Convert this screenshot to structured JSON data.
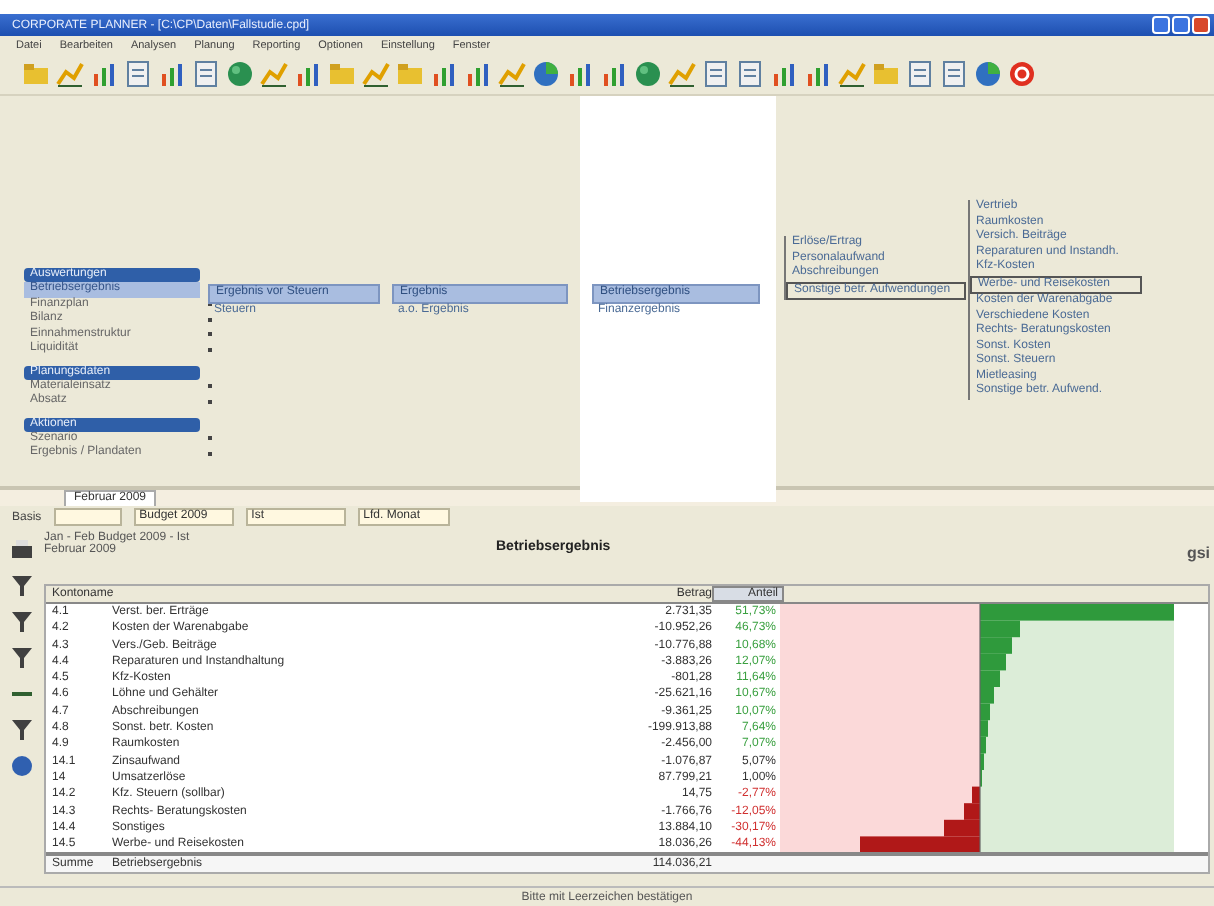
{
  "window": {
    "title": "CORPORATE PLANNER - [C:\\CP\\Daten\\Fallstudie.cpd]"
  },
  "menu": [
    "Datei",
    "Bearbeiten",
    "Analysen",
    "Planung",
    "Reporting",
    "Optionen",
    "Einstellung",
    "Fenster"
  ],
  "diagram": {
    "sidebar_groups": [
      {
        "title": "Auswertungen",
        "items": [
          {
            "label": "Betriebsergebnis",
            "selected": true
          },
          {
            "label": "Finanzplan",
            "selected": false
          },
          {
            "label": "Bilanz",
            "selected": false
          },
          {
            "label": "Einnahmenstruktur",
            "selected": false
          },
          {
            "label": "Liquidität",
            "selected": false
          }
        ]
      },
      {
        "title": "Planungsdaten",
        "items": [
          {
            "label": "Materialeinsatz",
            "selected": false
          },
          {
            "label": "Absatz",
            "selected": false
          }
        ]
      },
      {
        "title": "Aktionen",
        "items": [
          {
            "label": "Szenario",
            "selected": false
          },
          {
            "label": "Ergebnis / Plandaten",
            "selected": false
          }
        ]
      }
    ],
    "levels": [
      {
        "items": [
          {
            "label": "Ergebnis vor Steuern",
            "selected": true
          },
          {
            "label": "Steuern",
            "selected": false
          }
        ]
      },
      {
        "items": [
          {
            "label": "Ergebnis",
            "selected": true
          },
          {
            "label": "a.o. Ergebnis",
            "selected": false
          }
        ]
      },
      {
        "items": [
          {
            "label": "Betriebsergebnis",
            "selected": true
          },
          {
            "label": "Finanzergebnis",
            "selected": false
          }
        ]
      },
      {
        "items": [
          {
            "label": "Erlöse/Ertrag",
            "selected": false
          },
          {
            "label": "Personalaufwand",
            "selected": false
          },
          {
            "label": "Abschreibungen",
            "selected": false
          },
          {
            "label": "Sonstige betr. Aufwendungen",
            "selected": true
          }
        ]
      },
      {
        "items": [
          {
            "label": "Vertrieb",
            "selected": false
          },
          {
            "label": "Raumkosten",
            "selected": false
          },
          {
            "label": "Versich. Beiträge",
            "selected": false
          },
          {
            "label": "Reparaturen und Instandh.",
            "selected": false
          },
          {
            "label": "Kfz-Kosten",
            "selected": false
          },
          {
            "label": "Werbe- und Reisekosten",
            "selected": true
          },
          {
            "label": "Kosten der Warenabgabe",
            "selected": false
          },
          {
            "label": "Verschiedene Kosten",
            "selected": false
          },
          {
            "label": "Rechts- Beratungskosten",
            "selected": false
          },
          {
            "label": "Sonst. Kosten",
            "selected": false
          },
          {
            "label": "Sonst. Steuern",
            "selected": false
          },
          {
            "label": "Mietleasing",
            "selected": false
          },
          {
            "label": "Sonstige betr. Aufwend.",
            "selected": false
          }
        ]
      }
    ]
  },
  "report": {
    "tab": "Februar 2009",
    "filters": {
      "label": "Basis",
      "period": "Budget 2009",
      "version": "Ist",
      "range": "Lfd. Monat"
    },
    "subtitle_lines": [
      "Jan - Feb Budget 2009 - Ist",
      "Februar 2009"
    ],
    "title": "Betriebsergebnis",
    "logo": "gsi",
    "columns": [
      "Kontoname",
      "Betrag",
      "Anteil"
    ],
    "rows": [
      {
        "code": "4.1",
        "name": "Verst. ber. Erträge",
        "amount": "2.731,35",
        "share": "51,73%",
        "color": "#3aa040"
      },
      {
        "code": "4.2",
        "name": "Kosten der Warenabgabe",
        "amount": "-10.952,26",
        "share": "46,73%",
        "color": "#3aa040"
      },
      {
        "code": "4.3",
        "name": "Vers./Geb. Beiträge",
        "amount": "-10.776,88",
        "share": "10,68%",
        "color": "#3aa040"
      },
      {
        "code": "4.4",
        "name": "Reparaturen und Instandhaltung",
        "amount": "-3.883,26",
        "share": "12,07%",
        "color": "#3aa040"
      },
      {
        "code": "4.5",
        "name": "Kfz-Kosten",
        "amount": "-801,28",
        "share": "11,64%",
        "color": "#3aa040"
      },
      {
        "code": "4.6",
        "name": "Löhne und Gehälter",
        "amount": "-25.621,16",
        "share": "10,67%",
        "color": "#3aa040"
      },
      {
        "code": "4.7",
        "name": "Abschreibungen",
        "amount": "-9.361,25",
        "share": "10,07%",
        "color": "#3aa040"
      },
      {
        "code": "4.8",
        "name": "Sonst. betr. Kosten",
        "amount": "-199.913,88",
        "share": "7,64%",
        "color": "#3aa040"
      },
      {
        "code": "4.9",
        "name": "Raumkosten",
        "amount": "-2.456,00",
        "share": "7,07%",
        "color": "#3aa040"
      },
      {
        "code": "14.1",
        "name": "Zinsaufwand",
        "amount": "-1.076,87",
        "share": "5,07%",
        "color": "#333333"
      },
      {
        "code": "14",
        "name": "Umsatzerlöse",
        "amount": "87.799,21",
        "share": "1,00%",
        "color": "#333333"
      },
      {
        "code": "14.2",
        "name": "Kfz. Steuern (sollbar)",
        "amount": "14,75",
        "share": "-2,77%",
        "color": "#d03030"
      },
      {
        "code": "14.3",
        "name": "Rechts- Beratungskosten",
        "amount": "-1.766,76",
        "share": "-12,05%",
        "color": "#d03030"
      },
      {
        "code": "14.4",
        "name": "Sonstiges",
        "amount": "13.884,10",
        "share": "-30,17%",
        "color": "#d03030"
      },
      {
        "code": "14.5",
        "name": "Werbe- und Reisekosten",
        "amount": "18.036,26",
        "share": "-44,13%",
        "color": "#d03030"
      }
    ],
    "total": {
      "code": "Summe",
      "name": "Betriebsergebnis",
      "amount": "114.036,21"
    }
  },
  "status_bar": "Bitte mit Leerzeichen bestätigen"
}
